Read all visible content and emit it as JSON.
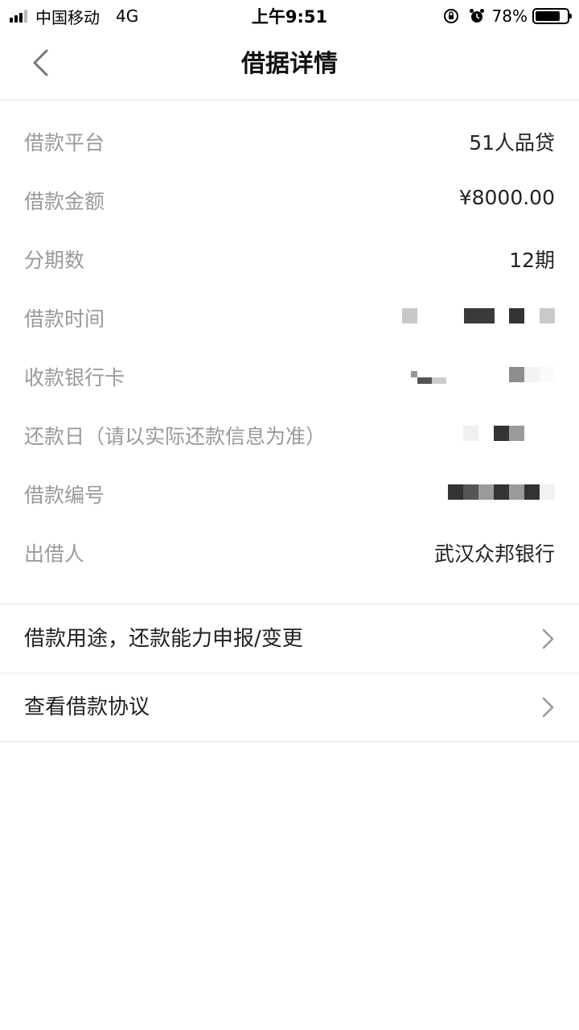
{
  "status_bar": {
    "carrier": "中国移动",
    "network": "4G",
    "time": "上午9:51",
    "battery_percent": "78%",
    "battery_level": 0.78
  },
  "nav": {
    "title": "借据详情",
    "back_icon": "chevron-left-icon"
  },
  "details": [
    {
      "label": "借款平台",
      "value": "51人品贷"
    },
    {
      "label": "借款金额",
      "value": "¥8000.00"
    },
    {
      "label": "分期数",
      "value": "12期"
    },
    {
      "label": "借款时间",
      "value": ""
    },
    {
      "label": "收款银行卡",
      "value": ""
    },
    {
      "label": "还款日（请以实际还款信息为准）",
      "value": ""
    },
    {
      "label": "借款编号",
      "value": ""
    },
    {
      "label": "出借人",
      "value": "武汉众邦银行"
    }
  ],
  "links": [
    {
      "label": "借款用途，还款能力申报/变更",
      "icon": "chevron-right-icon"
    },
    {
      "label": "查看借款协议",
      "icon": "chevron-right-icon"
    }
  ],
  "colors": {
    "label_gray": "#9a9a9a",
    "text_dark": "#222222",
    "divider": "#e8e8e8"
  }
}
